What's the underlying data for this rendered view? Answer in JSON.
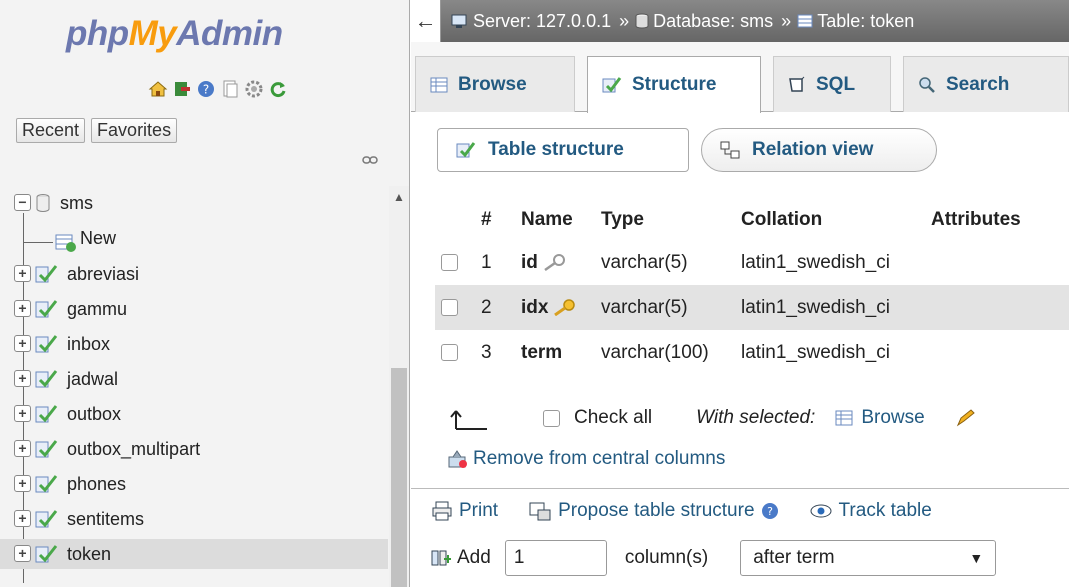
{
  "logo": {
    "php": "php",
    "my": "My",
    "admin": "Admin"
  },
  "nav": {
    "tabs": [
      "Recent",
      "Favorites"
    ],
    "database": "sms",
    "new_label": "New",
    "tables": [
      "abreviasi",
      "gammu",
      "inbox",
      "jadwal",
      "outbox",
      "outbox_multipart",
      "phones",
      "sentitems",
      "token"
    ],
    "active_table": "token",
    "icons": [
      "home-icon",
      "exit-icon",
      "help-icon",
      "docs-icon",
      "settings-icon",
      "reload-icon",
      "link-icon"
    ]
  },
  "breadcrumb": {
    "server": "Server: 127.0.0.1",
    "database": "Database: sms",
    "table": "Table: token",
    "separator": "»"
  },
  "tabs": [
    {
      "label": "Browse",
      "icon": "browse-icon"
    },
    {
      "label": "Structure",
      "icon": "structure-icon"
    },
    {
      "label": "SQL",
      "icon": "sql-icon"
    },
    {
      "label": "Search",
      "icon": "search-icon"
    }
  ],
  "active_tab": "Structure",
  "subtabs": [
    {
      "label": "Table structure",
      "icon": "table-structure-icon"
    },
    {
      "label": "Relation view",
      "icon": "relation-icon"
    }
  ],
  "columns_header": [
    "#",
    "Name",
    "Type",
    "Collation",
    "Attributes"
  ],
  "rows": [
    {
      "num": "1",
      "name": "id",
      "key": "index-key-icon",
      "type": "varchar(5)",
      "collation": "latin1_swedish_ci"
    },
    {
      "num": "2",
      "name": "idx",
      "key": "primary-key-icon",
      "type": "varchar(5)",
      "collation": "latin1_swedish_ci"
    },
    {
      "num": "3",
      "name": "term",
      "key": "",
      "type": "varchar(100)",
      "collation": "latin1_swedish_ci"
    }
  ],
  "actions": {
    "check_all": "Check all",
    "with_selected": "With selected:",
    "browse": "Browse",
    "remove_central": "Remove from central columns"
  },
  "bottom": {
    "print": "Print",
    "propose": "Propose table structure",
    "track": "Track table",
    "add": "Add",
    "add_count": "1",
    "columns_label": "column(s)",
    "position": "after term"
  },
  "colors": {
    "link": "#235a81",
    "logo_blue": "#6c78af",
    "logo_orange": "#f89c0e"
  }
}
